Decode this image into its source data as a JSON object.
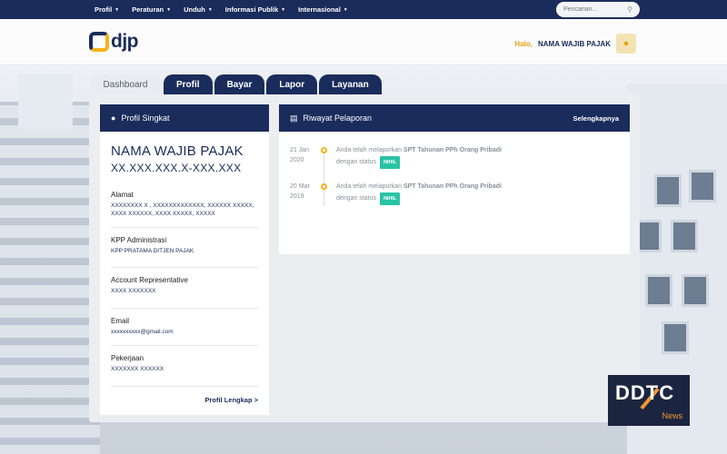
{
  "topnav": {
    "items": [
      {
        "label": "Profil"
      },
      {
        "label": "Peraturan"
      },
      {
        "label": "Unduh"
      },
      {
        "label": "Informasi Publik"
      },
      {
        "label": "Internasional"
      }
    ],
    "search_placeholder": "Pencarian..."
  },
  "header": {
    "logo_text": "djp",
    "greeting": "Halo,",
    "user_name": "NAMA WAJIB PAJAK"
  },
  "tabs": [
    {
      "label": "Dashboard"
    },
    {
      "label": "Profil"
    },
    {
      "label": "Bayar"
    },
    {
      "label": "Lapor"
    },
    {
      "label": "Layanan"
    }
  ],
  "profile": {
    "title": "Profil Singkat",
    "name": "NAMA WAJIB PAJAK",
    "npwp": "XX.XXX.XXX.X-XXX.XXX",
    "fields": [
      {
        "label": "Alamat",
        "value": "XXXXXXXX X , XXXXXXXXXXXXX, XXXXXX XXXXX, XXXX XXXXXX, XXXX XXXXX, XXXXX"
      },
      {
        "label": "KPP Administrasi",
        "value": "KPP PRATAMA DITJEN PAJAK"
      },
      {
        "label": "Account Representative",
        "value": "XXXX XXXXXXX"
      },
      {
        "label": "Email",
        "value": "xxxxxxxxxx@gmail.com"
      },
      {
        "label": "Pekerjaan",
        "value": "XXXXXXX XXXXXX"
      }
    ],
    "link": "Profil Lengkap >"
  },
  "report": {
    "title": "Riwayat Pelaporan",
    "more": "Selengkapnya",
    "items": [
      {
        "date": "21 Jan 2020",
        "text_pre": "Anda telah melaporkan ",
        "text_bold": "SPT Tahunan PPh Orang Pribadi",
        "text_post": " dengan status",
        "badge": "NIHIL"
      },
      {
        "date": "20 Mar 2019",
        "text_pre": "Anda telah melaporkan ",
        "text_bold": "SPT Tahunan PPh Orang Pribadi",
        "text_post": " dengan status",
        "badge": "NIHIL"
      }
    ]
  },
  "watermark": {
    "brand": "DDTC",
    "sub": "News"
  },
  "colors": {
    "navy": "#1a2c5b",
    "accent": "#f5b21a",
    "badge": "#28c4a6"
  }
}
